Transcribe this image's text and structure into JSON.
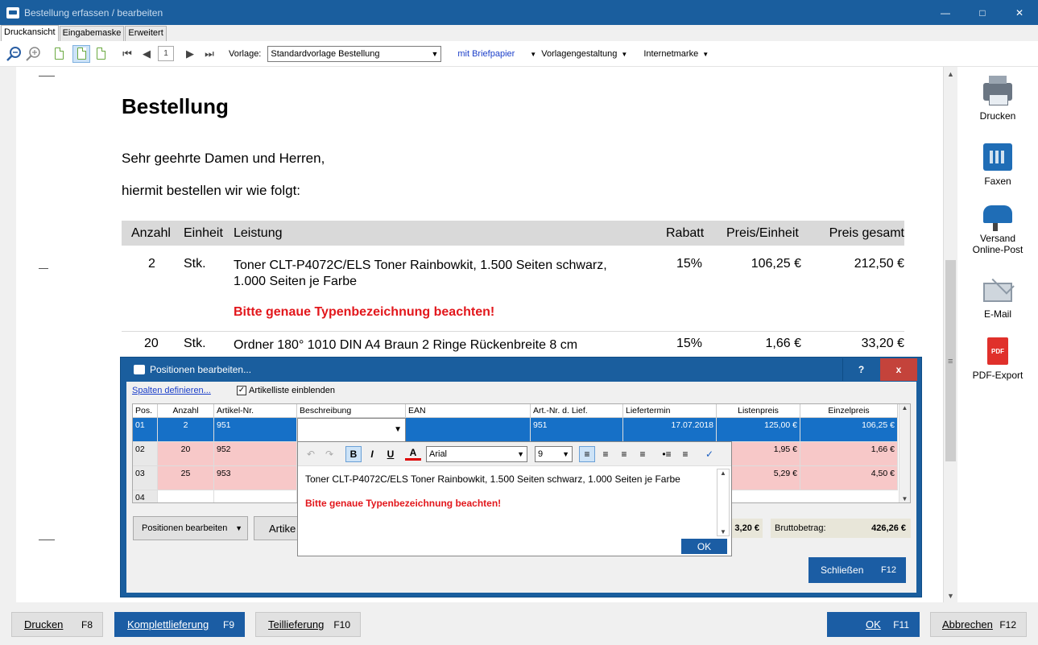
{
  "window": {
    "title": "Bestellung  erfassen / bearbeiten"
  },
  "tabs": [
    "Druckansicht",
    "Eingabemaske",
    "Erweitert"
  ],
  "toolbar": {
    "page": "1",
    "vorlage_label": "Vorlage:",
    "vorlage_value": "Standardvorlage Bestellung",
    "briefpapier": "mit Briefpapier",
    "vorlagengestaltung": "Vorlagengestaltung",
    "internetmarke": "Internetmarke"
  },
  "document": {
    "title": "Bestellung",
    "greeting": "Sehr geehrte Damen und Herren,",
    "intro": "hiermit bestellen wir wie folgt:",
    "headers": {
      "anzahl": "Anzahl",
      "einheit": "Einheit",
      "leistung": "Leistung",
      "rabatt": "Rabatt",
      "preis_einheit": "Preis/Einheit",
      "preis_gesamt": "Preis gesamt"
    },
    "rows": [
      {
        "anzahl": "2",
        "einheit": "Stk.",
        "leistung_1": "Toner CLT-P4072C/ELS Toner Rainbowkit, 1.500 Seiten schwarz,",
        "leistung_2": "1.000 Seiten je Farbe",
        "note": "Bitte genaue Typenbezeichnung beachten!",
        "rabatt": "15%",
        "preis_einheit": "106,25 €",
        "preis_gesamt": "212,50 €"
      },
      {
        "anzahl": "20",
        "einheit": "Stk.",
        "leistung_1": "Ordner 180° 1010 DIN A4 Braun 2 Ringe Rückenbreite 8 cm",
        "rabatt": "15%",
        "preis_einheit": "1,66 €",
        "preis_gesamt": "33,20 €"
      }
    ]
  },
  "sidebar": {
    "drucken": "Drucken",
    "faxen": "Faxen",
    "versand_1": "Versand",
    "versand_2": "Online-Post",
    "email": "E-Mail",
    "pdf": "PDF-Export",
    "pdf_icon_text": "PDF"
  },
  "bottom": {
    "drucken": "Drucken",
    "drucken_key": "F8",
    "komplett": "Komplettlieferung",
    "komplett_key": "F9",
    "teil": "Teillieferung",
    "teil_key": "F10",
    "ok": "OK",
    "ok_key": "F11",
    "abbrechen": "Abbrechen",
    "abbrechen_key": "F12"
  },
  "dialog": {
    "title": "Positionen bearbeiten...",
    "help": "?",
    "close": "x",
    "spalten_link": "Spalten definieren...",
    "artikelliste": "Artikelliste einblenden",
    "columns": [
      "Pos.",
      "Anzahl",
      "Artikel-Nr.",
      "Beschreibung",
      "EAN",
      "Art.-Nr. d. Lief.",
      "Liefertermin",
      "Listenpreis",
      "Einzelpreis"
    ],
    "rows": [
      {
        "pos": "01",
        "anzahl": "2",
        "artnr": "951",
        "lief": "951",
        "termin": "17.07.2018",
        "liste": "125,00 €",
        "einzel": "106,25 €"
      },
      {
        "pos": "02",
        "anzahl": "20",
        "artnr": "952",
        "liste": "1,95 €",
        "einzel": "1,66 €"
      },
      {
        "pos": "03",
        "anzahl": "25",
        "artnr": "953",
        "liste": "5,29 €",
        "einzel": "4,50 €"
      },
      {
        "pos": "04"
      }
    ],
    "positionen_btn": "Positionen bearbeiten",
    "artikel_btn": "Artike",
    "netto_value": "3,20 €",
    "brutto_label": "Bruttobetrag:",
    "brutto_value": "426,26 €",
    "schliessen": "Schließen",
    "schliessen_key": "F12"
  },
  "editor": {
    "font": "Arial",
    "size": "9",
    "line1": "Toner CLT-P4072C/ELS Toner Rainbowkit, 1.500 Seiten schwarz, 1.000 Seiten je Farbe",
    "line2": "Bitte genaue Typenbezeichnung beachten!",
    "ok": "OK"
  }
}
